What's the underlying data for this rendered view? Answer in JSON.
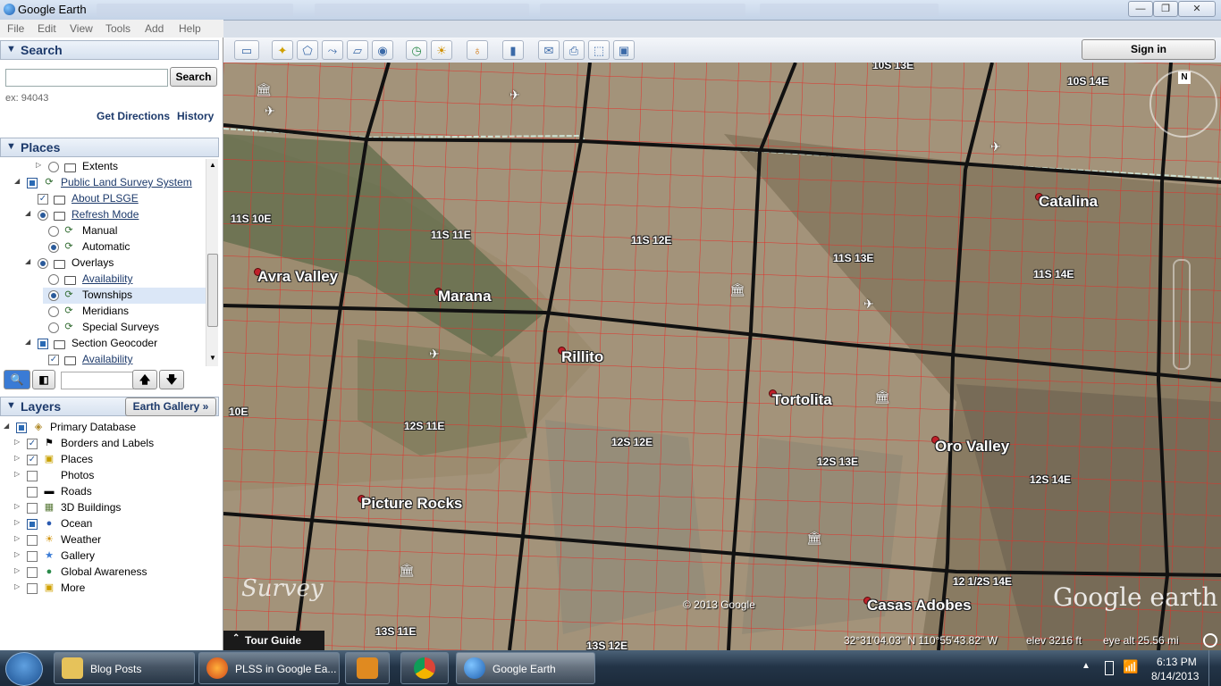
{
  "window": {
    "title": "Google Earth",
    "controls": [
      "—",
      "❐",
      "✕"
    ]
  },
  "menu": [
    "File",
    "Edit",
    "View",
    "Tools",
    "Add",
    "Help"
  ],
  "search": {
    "heading": "Search",
    "placeholder": "",
    "button": "Search",
    "example": "ex: 94043",
    "get_directions": "Get Directions",
    "history": "History"
  },
  "places": {
    "heading": "Places",
    "items": [
      {
        "label": "Extents"
      },
      {
        "label": "Public Land Survey System"
      },
      {
        "label": "About PLSGE"
      },
      {
        "label": "Refresh Mode"
      },
      {
        "label": "Manual"
      },
      {
        "label": "Automatic"
      },
      {
        "label": "Overlays"
      },
      {
        "label": "Availability"
      },
      {
        "label": "Townships"
      },
      {
        "label": "Meridians"
      },
      {
        "label": "Special Surveys"
      },
      {
        "label": "Section Geocoder"
      },
      {
        "label": "Availability"
      }
    ]
  },
  "layers": {
    "heading": "Layers",
    "earth_gallery": "Earth Gallery »",
    "items": [
      {
        "label": "Primary Database"
      },
      {
        "label": "Borders and Labels"
      },
      {
        "label": "Places"
      },
      {
        "label": "Photos"
      },
      {
        "label": "Roads"
      },
      {
        "label": "3D Buildings"
      },
      {
        "label": "Ocean"
      },
      {
        "label": "Weather"
      },
      {
        "label": "Gallery"
      },
      {
        "label": "Global Awareness"
      },
      {
        "label": "More"
      }
    ]
  },
  "toolbar": {
    "sign_in": "Sign in"
  },
  "map": {
    "townships": [
      "10S 13E",
      "10S 14E",
      "11S 10E",
      "11S 11E",
      "11S 12E",
      "11S 13E",
      "11S 14E",
      "12S 11E",
      "12S 12E",
      "12S 13E",
      "12S 14E",
      "12 1/2S 14E",
      "13S 11E",
      "13S 12E",
      "10E"
    ],
    "cities": [
      "Catalina",
      "Avra Valley",
      "Marana",
      "Rillito",
      "Tortolita",
      "Oro Valley",
      "Picture Rocks",
      "Casas Adobes"
    ],
    "copyright": "© 2013 Google",
    "watermark": "Survey",
    "logo": "Google earth",
    "north": "N"
  },
  "tour_guide": "Tour Guide",
  "status": {
    "coords": "32°31'04.03\" N  110°55'43.82\" W",
    "elev": "elev  3216 ft",
    "eye_alt": "eye alt  25.56 mi"
  },
  "taskbar": {
    "items": [
      "Blog Posts",
      "PLSS in Google Ea...",
      "",
      "",
      "Google Earth"
    ],
    "time": "6:13 PM",
    "date": "8/14/2013"
  }
}
